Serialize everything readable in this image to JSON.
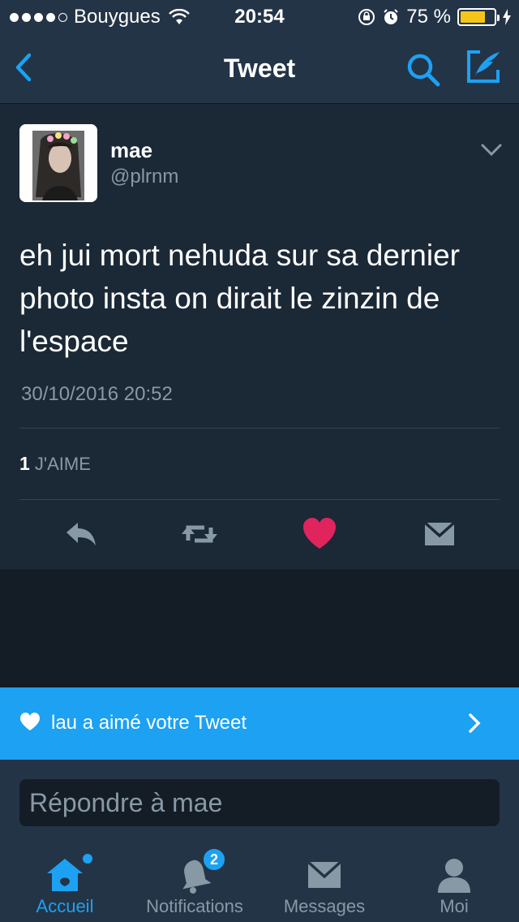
{
  "status_bar": {
    "carrier": "Bouygues",
    "time": "20:54",
    "battery_percent": "75 %",
    "battery_level": 0.75,
    "signal_bars": 4
  },
  "nav": {
    "title": "Tweet",
    "back_icon": "chevron-left-icon",
    "search_icon": "search-icon",
    "compose_icon": "compose-tweet-icon"
  },
  "tweet": {
    "author_name": "mae",
    "author_handle": "@plrnm",
    "text": "eh jui mort nehuda sur sa dernier photo insta on dirait le zinzin de l'espace",
    "date": "30/10/2016 20:52",
    "like_count": "1",
    "like_label": "J'AIME",
    "liked": true,
    "actions": [
      "reply-icon",
      "retweet-icon",
      "heart-icon",
      "direct-message-icon"
    ]
  },
  "banner": {
    "text": "lau a aimé votre Tweet"
  },
  "reply": {
    "placeholder": "Répondre à mae"
  },
  "tabs": [
    {
      "label": "Accueil",
      "icon": "home-icon",
      "active": true,
      "has_dot": true
    },
    {
      "label": "Notifications",
      "icon": "bell-icon",
      "badge": "2"
    },
    {
      "label": "Messages",
      "icon": "envelope-icon"
    },
    {
      "label": "Moi",
      "icon": "person-icon"
    }
  ],
  "colors": {
    "accent": "#1da1f2",
    "like": "#e0245e",
    "background": "#141d26",
    "surface": "#1b2836",
    "bar": "#243447",
    "muted": "#8899a6"
  }
}
